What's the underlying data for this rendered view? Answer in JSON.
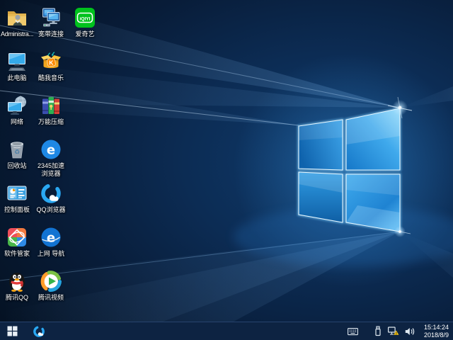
{
  "desktop": {
    "icons": [
      {
        "name": "administrator-folder",
        "label": "Administra..."
      },
      {
        "name": "this-pc",
        "label": "此电脑"
      },
      {
        "name": "network",
        "label": "网络"
      },
      {
        "name": "recycle-bin",
        "label": "回收站"
      },
      {
        "name": "control-panel",
        "label": "控制面板"
      },
      {
        "name": "software-manager",
        "label": "软件管家"
      },
      {
        "name": "tencent-qq",
        "label": "腾讯QQ"
      },
      {
        "name": "broadband-connection",
        "label": "宽带连接"
      },
      {
        "name": "kuwo-music",
        "label": "酷我音乐",
        "glyph": "K"
      },
      {
        "name": "universal-compression",
        "label": "万能压缩"
      },
      {
        "name": "2345-speed-browser",
        "label": "2345加速浏览器",
        "glyph": "e"
      },
      {
        "name": "qq-browser",
        "label": "QQ浏览器"
      },
      {
        "name": "web-navigation",
        "label": "上网 导航",
        "glyph": "e"
      },
      {
        "name": "tencent-video",
        "label": "腾讯视频"
      },
      {
        "name": "iqiyi",
        "label": "爱奇艺",
        "glyph": "iQIYI"
      }
    ]
  },
  "taskbar": {
    "pinned_icons": [
      "windows-start-icon",
      "qq-browser-icon"
    ],
    "tray_icons": [
      "touch-keyboard-icon",
      "usb-device-icon",
      "network-warning-icon",
      "volume-icon"
    ],
    "clock": {
      "time": "15:14:24",
      "date": "2018/8/9"
    }
  },
  "colors": {
    "taskbar_bg": "#0d2342",
    "wallpaper_base": "#081c38",
    "logo_blue": "#2f9fe8",
    "accent_blue": "#2aa8f2",
    "warning_yellow": "#f8c514",
    "iqiyi_green": "#00c21d"
  }
}
